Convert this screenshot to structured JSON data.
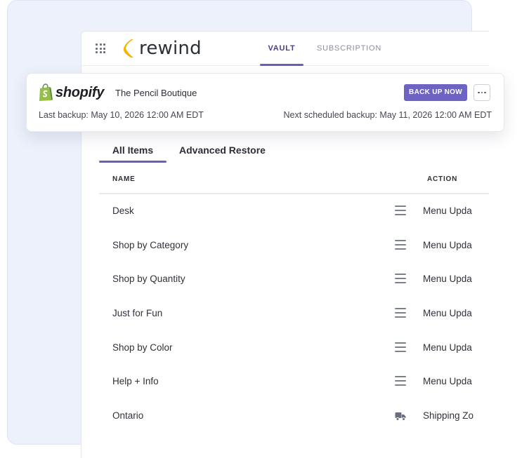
{
  "brand": {
    "name": "rewind",
    "accent": "#6c63c2",
    "logo_color": "#f5b400"
  },
  "nav": {
    "tabs": [
      {
        "label": "VAULT",
        "active": true
      },
      {
        "label": "SUBSCRIPTION",
        "active": false
      }
    ]
  },
  "store": {
    "platform": "shopify",
    "name": "The Pencil Boutique",
    "backup_button": "BACK UP NOW",
    "last_backup": "Last backup: May 10, 2026 12:00 AM EDT",
    "next_backup": "Next scheduled backup: May 11, 2026 12:00 AM EDT"
  },
  "sub_tabs": [
    {
      "label": "All Items",
      "active": true
    },
    {
      "label": "Advanced Restore",
      "active": false
    }
  ],
  "table": {
    "columns": {
      "name": "NAME",
      "action": "ACTION"
    },
    "rows": [
      {
        "name": "Desk",
        "icon": "menu-icon",
        "action": "Menu Upda"
      },
      {
        "name": "Shop by Category",
        "icon": "menu-icon",
        "action": "Menu Upda"
      },
      {
        "name": "Shop by Quantity",
        "icon": "menu-icon",
        "action": "Menu Upda"
      },
      {
        "name": "Just for Fun",
        "icon": "menu-icon",
        "action": "Menu Upda"
      },
      {
        "name": "Shop by Color",
        "icon": "menu-icon",
        "action": "Menu Upda"
      },
      {
        "name": "Help + Info",
        "icon": "menu-icon",
        "action": "Menu Upda"
      },
      {
        "name": "Ontario",
        "icon": "truck-icon",
        "action": "Shipping Zo"
      }
    ]
  }
}
